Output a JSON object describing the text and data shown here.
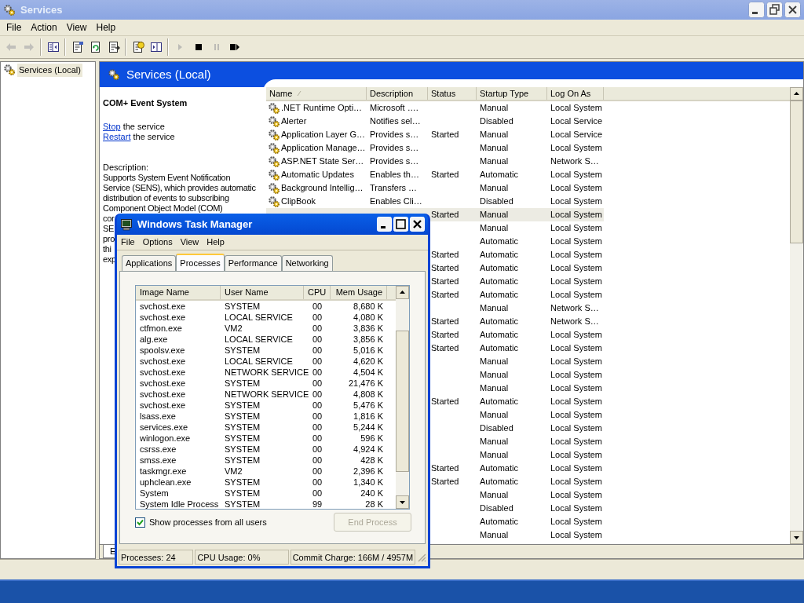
{
  "window": {
    "title": "Services"
  },
  "menu": [
    "File",
    "Action",
    "View",
    "Help"
  ],
  "toolbar": [
    [
      {
        "kind": "back",
        "disabled": true
      },
      {
        "kind": "forward",
        "disabled": true
      }
    ],
    [
      {
        "kind": "tree",
        "disabled": false
      }
    ],
    [
      {
        "kind": "properties",
        "disabled": false
      },
      {
        "kind": "refresh",
        "disabled": false
      },
      {
        "kind": "export",
        "disabled": false
      }
    ],
    [
      {
        "kind": "help",
        "disabled": false
      },
      {
        "kind": "pane",
        "disabled": false
      }
    ],
    [
      {
        "kind": "start",
        "disabled": true
      },
      {
        "kind": "stop",
        "disabled": false
      },
      {
        "kind": "pause",
        "disabled": true
      },
      {
        "kind": "restart",
        "disabled": false
      }
    ]
  ],
  "tree": [
    {
      "label": "Services (Local)",
      "selected": true
    }
  ],
  "header": {
    "title": "Services (Local)"
  },
  "details": {
    "service": "COM+ Event System",
    "actions": [
      {
        "link": "Stop",
        "text": " the service"
      },
      {
        "link": "Restart",
        "text": " the service"
      }
    ],
    "description_label": "Description:",
    "description_lines": [
      "Supports System Event Notification",
      "Service (SENS), which provides automatic",
      "distribution of events to subscribing",
      "Component Object Model (COM)",
      "cor",
      "SE",
      "pro",
      "thi",
      "exp"
    ]
  },
  "list": {
    "columns": [
      {
        "label": "Name",
        "sorted": true
      },
      {
        "label": "Description",
        "sorted": false
      },
      {
        "label": "Status",
        "sorted": false
      },
      {
        "label": "Startup Type",
        "sorted": false
      },
      {
        "label": "Log On As",
        "sorted": false
      }
    ],
    "rows": [
      {
        "name": ".NET Runtime Opti…",
        "description": "Microsoft ….",
        "startup": "Manual",
        "logon": "Local System",
        "selected": false
      },
      {
        "name": "Alerter",
        "description": "Notifies sel…",
        "startup": "Disabled",
        "logon": "Local Service",
        "selected": false
      },
      {
        "name": "Application Layer G…",
        "description": "Provides s…",
        "status": "Started",
        "startup": "Manual",
        "logon": "Local Service",
        "selected": false
      },
      {
        "name": "Application Manage…",
        "description": "Provides s…",
        "startup": "Manual",
        "logon": "Local System",
        "selected": false
      },
      {
        "name": "ASP.NET State Ser…",
        "description": "Provides s…",
        "startup": "Manual",
        "logon": "Network S…",
        "selected": false
      },
      {
        "name": "Automatic Updates",
        "description": "Enables th…",
        "status": "Started",
        "startup": "Automatic",
        "logon": "Local System",
        "selected": false
      },
      {
        "name": "Background Intellig…",
        "description": "Transfers …",
        "startup": "Manual",
        "logon": "Local System",
        "selected": false
      },
      {
        "name": "ClipBook",
        "description": "Enables Cli…",
        "startup": "Disabled",
        "logon": "Local System",
        "selected": false
      },
      {
        "status": "Started",
        "startup": "Manual",
        "logon": "Local System",
        "selected": true
      },
      {
        "startup": "Manual",
        "logon": "Local System",
        "selected": false
      },
      {
        "startup": "Automatic",
        "logon": "Local System",
        "selected": false
      },
      {
        "status": "Started",
        "startup": "Automatic",
        "logon": "Local System",
        "selected": false
      },
      {
        "status": "Started",
        "startup": "Automatic",
        "logon": "Local System",
        "selected": false
      },
      {
        "status": "Started",
        "startup": "Automatic",
        "logon": "Local System",
        "selected": false
      },
      {
        "status": "Started",
        "startup": "Automatic",
        "logon": "Local System",
        "selected": false
      },
      {
        "startup": "Manual",
        "logon": "Network S…",
        "selected": false
      },
      {
        "status": "Started",
        "startup": "Automatic",
        "logon": "Network S…",
        "selected": false
      },
      {
        "status": "Started",
        "startup": "Automatic",
        "logon": "Local System",
        "selected": false
      },
      {
        "status": "Started",
        "startup": "Automatic",
        "logon": "Local System",
        "selected": false
      },
      {
        "startup": "Manual",
        "logon": "Local System",
        "selected": false
      },
      {
        "startup": "Manual",
        "logon": "Local System",
        "selected": false
      },
      {
        "startup": "Manual",
        "logon": "Local System",
        "selected": false
      },
      {
        "status": "Started",
        "startup": "Automatic",
        "logon": "Local System",
        "selected": false
      },
      {
        "startup": "Manual",
        "logon": "Local System",
        "selected": false
      },
      {
        "startup": "Disabled",
        "logon": "Local System",
        "selected": false
      },
      {
        "startup": "Manual",
        "logon": "Local System",
        "selected": false
      },
      {
        "startup": "Manual",
        "logon": "Local System",
        "selected": false
      },
      {
        "status": "Started",
        "startup": "Automatic",
        "logon": "Local System",
        "selected": false
      },
      {
        "status": "Started",
        "startup": "Automatic",
        "logon": "Local System",
        "selected": false
      },
      {
        "startup": "Manual",
        "logon": "Local System",
        "selected": false
      },
      {
        "startup": "Disabled",
        "logon": "Local System",
        "selected": false
      },
      {
        "startup": "Automatic",
        "logon": "Local System",
        "selected": false
      },
      {
        "startup": "Manual",
        "logon": "Local System",
        "selected": false
      }
    ]
  },
  "view_tabs": [
    {
      "label": "E"
    }
  ],
  "task_manager": {
    "title": "Windows Task Manager",
    "menu": [
      "File",
      "Options",
      "View",
      "Help"
    ],
    "tabs": [
      {
        "label": "Applications",
        "selected": false
      },
      {
        "label": "Processes",
        "selected": true
      },
      {
        "label": "Performance",
        "selected": false
      },
      {
        "label": "Networking",
        "selected": false
      }
    ],
    "columns": [
      "Image Name",
      "User Name",
      "CPU",
      "Mem Usage"
    ],
    "processes": [
      [
        "svchost.exe",
        "SYSTEM",
        "00",
        "8,680 K"
      ],
      [
        "svchost.exe",
        "LOCAL SERVICE",
        "00",
        "4,080 K"
      ],
      [
        "ctfmon.exe",
        "VM2",
        "00",
        "3,836 K"
      ],
      [
        "alg.exe",
        "LOCAL SERVICE",
        "00",
        "3,856 K"
      ],
      [
        "spoolsv.exe",
        "SYSTEM",
        "00",
        "5,016 K"
      ],
      [
        "svchost.exe",
        "LOCAL SERVICE",
        "00",
        "4,620 K"
      ],
      [
        "svchost.exe",
        "NETWORK SERVICE",
        "00",
        "4,504 K"
      ],
      [
        "svchost.exe",
        "SYSTEM",
        "00",
        "21,476 K"
      ],
      [
        "svchost.exe",
        "NETWORK SERVICE",
        "00",
        "4,808 K"
      ],
      [
        "svchost.exe",
        "SYSTEM",
        "00",
        "5,476 K"
      ],
      [
        "lsass.exe",
        "SYSTEM",
        "00",
        "1,816 K"
      ],
      [
        "services.exe",
        "SYSTEM",
        "00",
        "5,244 K"
      ],
      [
        "winlogon.exe",
        "SYSTEM",
        "00",
        "596 K"
      ],
      [
        "csrss.exe",
        "SYSTEM",
        "00",
        "4,924 K"
      ],
      [
        "smss.exe",
        "SYSTEM",
        "00",
        "428 K"
      ],
      [
        "taskmgr.exe",
        "VM2",
        "00",
        "2,396 K"
      ],
      [
        "uphclean.exe",
        "SYSTEM",
        "00",
        "1,340 K"
      ],
      [
        "System",
        "SYSTEM",
        "00",
        "240 K"
      ],
      [
        "System Idle Process",
        "SYSTEM",
        "99",
        "28 K"
      ]
    ],
    "show_all_users": {
      "label": "Show processes from all users",
      "checked": true
    },
    "end_process": {
      "label": "End Process",
      "disabled": true
    },
    "status": [
      "Processes: 24",
      "CPU Usage: 0%",
      "Commit Charge: 166M / 4957M"
    ]
  }
}
